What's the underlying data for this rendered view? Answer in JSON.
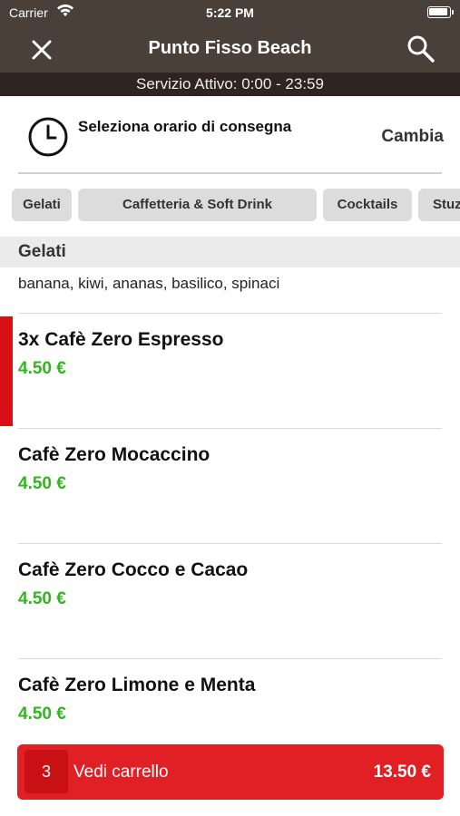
{
  "status_bar": {
    "carrier": "Carrier",
    "time": "5:22 PM"
  },
  "nav": {
    "title": "Punto Fisso Beach"
  },
  "service": {
    "text": "Servizio Attivo: 0:00 - 23:59"
  },
  "delivery": {
    "label": "Seleziona orario di consegna",
    "action": "Cambia"
  },
  "categories": [
    "Gelati",
    "Caffetteria & Soft Drink",
    "Cocktails",
    "Stuzz"
  ],
  "section": {
    "title": "Gelati",
    "description": "banana, kiwi, ananas, basilico, spinaci"
  },
  "items": [
    {
      "name": "3x Cafè Zero Espresso",
      "price": "4.50 €"
    },
    {
      "name": "Cafè Zero Mocaccino",
      "price": "4.50 €"
    },
    {
      "name": "Cafè Zero Cocco e Cacao",
      "price": "4.50 €"
    },
    {
      "name": "Cafè Zero Limone e Menta",
      "price": "4.50 €"
    }
  ],
  "cart": {
    "count": "3",
    "label": "Vedi carrello",
    "total": "13.50 €"
  },
  "colors": {
    "header": "#4a403a",
    "service_bar": "#2f2420",
    "price": "#2fb81b",
    "accent": "#d80f14",
    "cart": "#e02024"
  }
}
